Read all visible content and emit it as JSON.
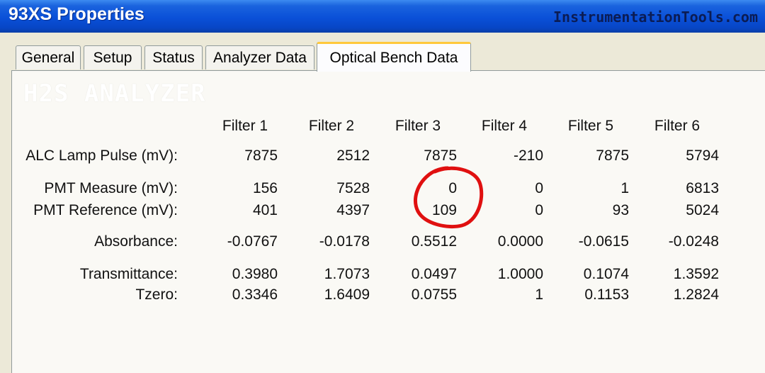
{
  "window": {
    "title": "93XS Properties",
    "watermark": "InstrumentationTools.com"
  },
  "tabs": [
    {
      "label": "General",
      "active": false
    },
    {
      "label": "Setup",
      "active": false
    },
    {
      "label": "Status",
      "active": false
    },
    {
      "label": "Analyzer Data",
      "active": false
    },
    {
      "label": "Optical Bench Data",
      "active": true
    }
  ],
  "panel": {
    "heading": "H2S ANALYZER",
    "columns": [
      "Filter 1",
      "Filter 2",
      "Filter 3",
      "Filter 4",
      "Filter 5",
      "Filter 6"
    ],
    "rows": [
      {
        "label": "ALC Lamp Pulse (mV):",
        "values": [
          "7875",
          "2512",
          "7875",
          "-210",
          "7875",
          "5794"
        ]
      },
      {
        "label": "PMT Measure (mV):",
        "values": [
          "156",
          "7528",
          "0",
          "0",
          "1",
          "6813"
        ]
      },
      {
        "label": "PMT Reference (mV):",
        "values": [
          "401",
          "4397",
          "109",
          "0",
          "93",
          "5024"
        ]
      },
      {
        "label": "Absorbance:",
        "values": [
          "-0.0767",
          "-0.0178",
          "0.5512",
          "0.0000",
          "-0.0615",
          "-0.0248"
        ]
      },
      {
        "label": "Transmittance:",
        "values": [
          "0.3980",
          "1.7073",
          "0.0497",
          "1.0000",
          "0.1074",
          "1.3592"
        ]
      },
      {
        "label": "Tzero:",
        "values": [
          "0.3346",
          "1.6409",
          "0.0755",
          "1",
          "0.1153",
          "1.2824"
        ]
      }
    ]
  },
  "colors": {
    "titlebar": "#0a50d8",
    "annotation": "#e01010",
    "active_tab_accent": "#ffc83c"
  }
}
